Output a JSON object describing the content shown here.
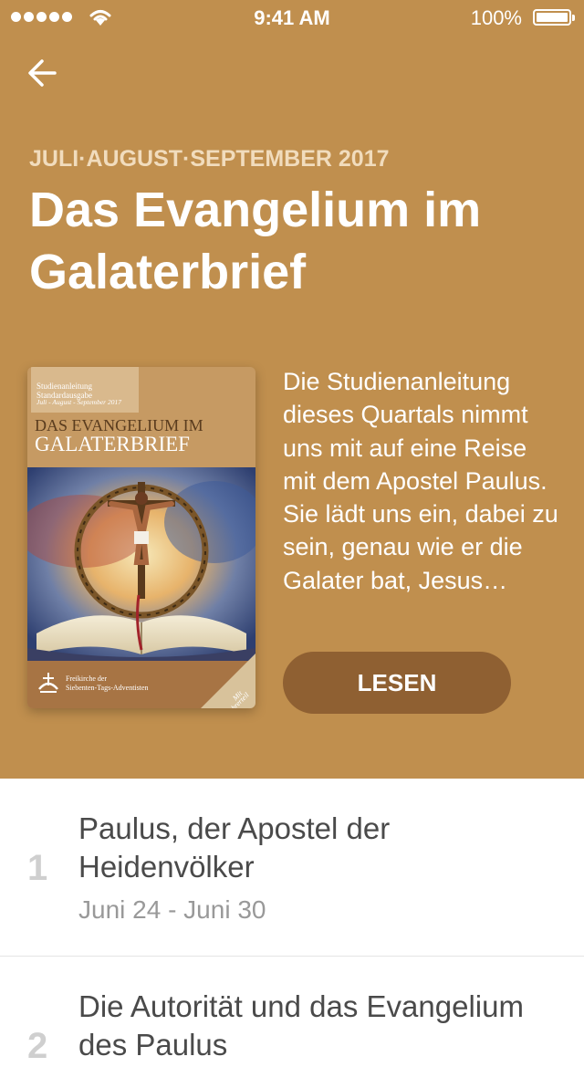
{
  "status_bar": {
    "time": "9:41 AM",
    "battery": "100%"
  },
  "header": {
    "back_icon": "arrow-left-icon",
    "quarter": "JULI·AUGUST·SEPTEMBER 2017",
    "title": "Das Evangelium im Galaterbrief"
  },
  "cover": {
    "series_line1": "Studienanleitung",
    "series_line2": "Standardausgabe",
    "subtitle": "Juli - August - September 2017",
    "title_line1": "DAS EVANGELIUM IM",
    "title_line2": "GALATERBRIEF",
    "publisher_line1": "Freikirche der",
    "publisher_line2": "Siebenten-Tags-Adventisten",
    "corner_line1": "Mit",
    "corner_line2": "Lehrerteil"
  },
  "description": "Die Studienanleitung dieses Quartals nimmt uns mit auf eine Reise mit dem Apostel Paulus. Sie lädt uns ein, dabei zu sein, genau wie er die Galater bat, Jesus…",
  "read_button": "LESEN",
  "lessons": [
    {
      "number": "1",
      "title": "Paulus, der Apostel der Heidenvölker",
      "date": "Juni 24 - Juni 30"
    },
    {
      "number": "2",
      "title": "Die Autorität und das Evangelium des Paulus",
      "date": ""
    }
  ],
  "colors": {
    "hero_background": "#c08f4e",
    "button_background": "#8f6032",
    "quarter_text": "#f1dcbd"
  }
}
